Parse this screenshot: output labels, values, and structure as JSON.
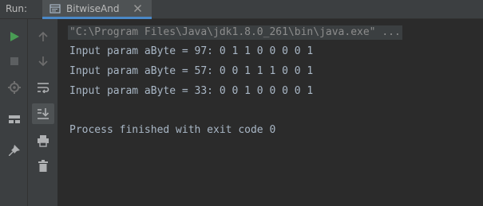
{
  "header": {
    "run_label": "Run:",
    "tab_title": "BitwiseAnd"
  },
  "console": {
    "command": "\"C:\\Program Files\\Java\\jdk1.8.0_261\\bin\\java.exe\" ...",
    "lines": [
      "Input param aByte = 97: 0 1 1 0 0 0 0 1",
      "Input param aByte = 57: 0 0 1 1 1 0 0 1",
      "Input param aByte = 33: 0 0 1 0 0 0 0 1"
    ],
    "exit_message": "Process finished with exit code 0"
  },
  "colors": {
    "accent": "#4a88c7",
    "run_green": "#499c54",
    "console_text": "#a9b7c6"
  }
}
